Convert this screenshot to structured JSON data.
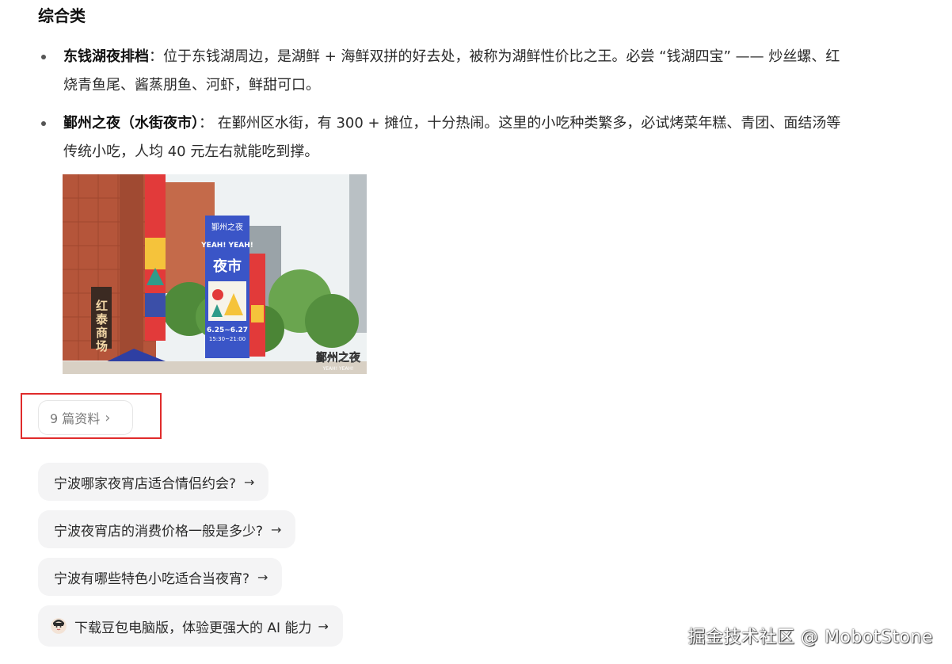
{
  "section_title": "综合类",
  "bullets": [
    {
      "title": "东钱湖夜排档",
      "body": "：位于东钱湖周边，是湖鲜 + 海鲜双拼的好去处，被称为湖鲜性价比之王。必尝 “钱湖四宝” —— 炒丝螺、红烧青鱼尾、酱蒸朋鱼、河虾，鲜甜可口。"
    },
    {
      "title": "鄞州之夜（水街夜市）",
      "body": "： 在鄞州区水街，有 300 + 摊位，十分热闹。这里的小吃种类繁多，必试烤菜年糕、青团、面结汤等传统小吃，人均 40 元左右就能吃到撑。"
    }
  ],
  "photo": {
    "banner_brand": "鄞州之夜",
    "banner_yeah": "YEAH! YEAH!",
    "banner_nightmarket": "夜市",
    "banner_dates": "6.25~6.27",
    "banner_hours": "15:30~21:00",
    "mall_sign": "红泰商场",
    "corner_label": "鄞州之夜",
    "corner_sub": "YEAH! YEAH!"
  },
  "sources": {
    "label": "9 篇资料",
    "highlight_color": "#e02b2b"
  },
  "suggestions": [
    "宁波哪家夜宵店适合情侣约会?",
    "宁波夜宵店的消费价格一般是多少?",
    "宁波有哪些特色小吃适合当夜宵?"
  ],
  "arrow_glyph": "→",
  "download": {
    "label": "下载豆包电脑版，体验更强大的 AI 能力"
  },
  "watermark": "掘金技术社区 @ MobotStone"
}
